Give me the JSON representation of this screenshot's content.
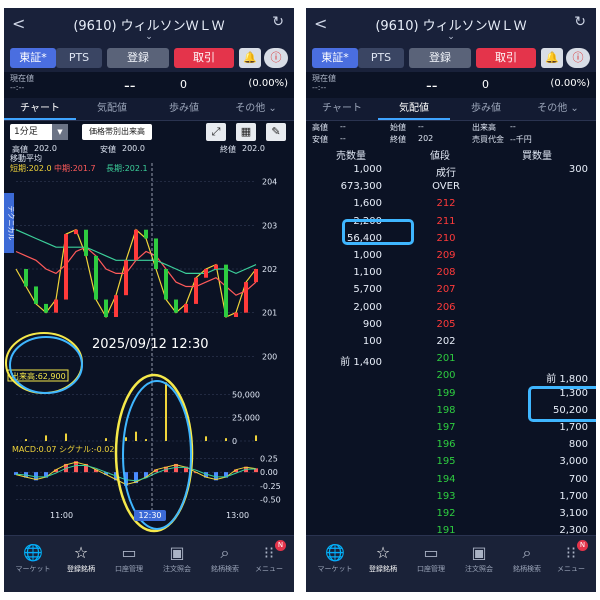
{
  "left": {
    "header": {
      "back": "<",
      "title": "(9610) ウィルソンＷＬＷ",
      "chevron": "⌄",
      "refresh": "↻"
    },
    "buttons": {
      "tosho": "東証*",
      "pts": "PTS",
      "register": "登録",
      "trade": "取引",
      "bell": "🔔",
      "info": "ⓘ"
    },
    "price": {
      "label1": "現在値",
      "label2": "--:--",
      "value": "--",
      "change": "0",
      "pct": "(0.00%)"
    },
    "tabs": [
      "チャート",
      "気配値",
      "歩み値",
      "その他 ⌄"
    ],
    "toolbar": {
      "interval": "1分足",
      "volume_by_price": "価格帯別出来高",
      "expand_icon": "⤢",
      "grid_icon": "▦",
      "pen_icon": "✎"
    },
    "hl": {
      "high": "高値",
      "high_v": "202.0",
      "low": "安値",
      "low_v": "200.0",
      "close": "終値",
      "close_v": "202.0"
    },
    "ma": {
      "label": "移動平均",
      "short": "短期:202.0",
      "mid": "中期:201.7",
      "long": "長期:202.1"
    },
    "side_tab": "テクニカル",
    "chart_data": [
      {
        "type": "line",
        "title": "",
        "y_ticks": [
          "204",
          "203",
          "202",
          "201",
          "200"
        ],
        "ylim": [
          199.8,
          204.2
        ],
        "series": [
          {
            "name": "短期",
            "color": "#f0d43a",
            "values": [
              202.0,
              201.6,
              201.2,
              201.0,
              201.3,
              202.8,
              202.9,
              202.3,
              201.3,
              200.9,
              201.4,
              202.2,
              202.9,
              202.7,
              202.0,
              201.3,
              201.0,
              201.2,
              201.8,
              202.0,
              202.1,
              200.9,
              201.0,
              201.7,
              202.0
            ]
          },
          {
            "name": "中期",
            "color": "#ff5a5a",
            "values": [
              202.4,
              202.3,
              202.2,
              202.0,
              201.9,
              202.1,
              202.4,
              202.5,
              202.3,
              202.0,
              201.9,
              201.9,
              202.2,
              202.4,
              202.3,
              202.0,
              201.7,
              201.6,
              201.6,
              201.7,
              201.8,
              201.6,
              201.4,
              201.5,
              201.7
            ]
          },
          {
            "name": "長期",
            "color": "#3ccf9a",
            "values": [
              202.9,
              202.8,
              202.7,
              202.6,
              202.5,
              202.5,
              202.5,
              202.5,
              202.4,
              202.3,
              202.2,
              202.2,
              202.2,
              202.2,
              202.2,
              202.1,
              202.0,
              201.9,
              201.9,
              201.9,
              202.0,
              202.0,
              201.9,
              202.0,
              202.1
            ]
          }
        ]
      },
      {
        "type": "bar",
        "title": "出来高:62,900",
        "y_ticks": [
          "50,000",
          "25,000",
          "0"
        ],
        "ylim": [
          0,
          60000
        ],
        "values": [
          0,
          2000,
          0,
          6000,
          0,
          8000,
          0,
          0,
          0,
          3000,
          0,
          4000,
          10000,
          2000,
          0,
          62900,
          0,
          0,
          0,
          5000,
          0,
          3000,
          0,
          0,
          6000
        ]
      },
      {
        "type": "bar",
        "title": "MACD:0.07 シグナル:-0.02",
        "y_ticks": [
          "0.25",
          "0.00",
          "-0.25",
          "-0.50"
        ],
        "ylim": [
          -0.6,
          0.35
        ],
        "values": [
          -0.05,
          -0.1,
          -0.15,
          -0.1,
          0.05,
          0.15,
          0.2,
          0.15,
          0.05,
          -0.05,
          -0.15,
          -0.25,
          -0.2,
          -0.1,
          0.05,
          0.1,
          0.15,
          0.1,
          0.0,
          -0.1,
          -0.15,
          -0.1,
          0.05,
          0.1,
          0.07
        ]
      }
    ],
    "cursor": {
      "datetime": "2025/09/12 12:30",
      "time_label": "12:30"
    },
    "x_ticks": [
      "11:00",
      "13:00"
    ]
  },
  "right": {
    "header": {
      "back": "<",
      "title": "(9610) ウィルソンＷＬＷ",
      "chevron": "⌄",
      "refresh": "↻"
    },
    "buttons": {
      "tosho": "東証*",
      "pts": "PTS",
      "register": "登録",
      "trade": "取引",
      "bell": "🔔",
      "info": "ⓘ"
    },
    "price": {
      "label1": "現在値",
      "label2": "--:--",
      "value": "--",
      "change": "0",
      "pct": "(0.00%)"
    },
    "tabs": [
      "チャート",
      "気配値",
      "歩み値",
      "その他 ⌄"
    ],
    "stats": {
      "high": "高値",
      "high_v": "--",
      "open": "始値",
      "open_v": "--",
      "turnover": "出来高",
      "turnover_v": "--",
      "low": "安値",
      "low_v": "--",
      "close": "終値",
      "close_v": "202",
      "amount": "売買代金",
      "amount_v": "--千円"
    },
    "book_head": {
      "sell": "売数量",
      "price": "値段",
      "buy": "買数量"
    },
    "book": [
      {
        "sell": "1,000",
        "price": "成行",
        "buy": "300",
        "pc": "white"
      },
      {
        "sell": "673,300",
        "price": "OVER",
        "buy": "",
        "pc": "white"
      },
      {
        "sell": "1,600",
        "price": "212",
        "buy": "",
        "pc": "red"
      },
      {
        "sell": "2,200",
        "price": "211",
        "buy": "",
        "pc": "red"
      },
      {
        "sell": "56,400",
        "price": "210",
        "buy": "",
        "pc": "red"
      },
      {
        "sell": "1,000",
        "price": "209",
        "buy": "",
        "pc": "red"
      },
      {
        "sell": "1,100",
        "price": "208",
        "buy": "",
        "pc": "red"
      },
      {
        "sell": "5,700",
        "price": "207",
        "buy": "",
        "pc": "red"
      },
      {
        "sell": "2,000",
        "price": "206",
        "buy": "",
        "pc": "red"
      },
      {
        "sell": "900",
        "price": "205",
        "buy": "",
        "pc": "red"
      },
      {
        "sell": "100",
        "price": "202",
        "buy": "",
        "pc": "white"
      },
      {
        "sell": "前 1,400",
        "price": "201",
        "buy": "",
        "pc": "green"
      },
      {
        "sell": "",
        "price": "200",
        "buy": "前 1,800",
        "pc": "green"
      },
      {
        "sell": "",
        "price": "199",
        "buy": "1,300",
        "pc": "green"
      },
      {
        "sell": "",
        "price": "198",
        "buy": "50,200",
        "pc": "green"
      },
      {
        "sell": "",
        "price": "197",
        "buy": "1,700",
        "pc": "green"
      },
      {
        "sell": "",
        "price": "196",
        "buy": "800",
        "pc": "green"
      },
      {
        "sell": "",
        "price": "195",
        "buy": "3,000",
        "pc": "green"
      },
      {
        "sell": "",
        "price": "194",
        "buy": "700",
        "pc": "green"
      },
      {
        "sell": "",
        "price": "193",
        "buy": "1,700",
        "pc": "green"
      },
      {
        "sell": "",
        "price": "192",
        "buy": "3,100",
        "pc": "green"
      },
      {
        "sell": "",
        "price": "191",
        "buy": "2,300",
        "pc": "green"
      }
    ]
  },
  "footer": [
    {
      "icon": "🌐",
      "label": "マーケット"
    },
    {
      "icon": "☆",
      "label": "登録銘柄"
    },
    {
      "icon": "▭",
      "label": "口座管理"
    },
    {
      "icon": "▣",
      "label": "注文照会"
    },
    {
      "icon": "⌕",
      "label": "銘柄検索"
    },
    {
      "icon": "⁝⁝",
      "label": "メニュー",
      "badge": "N"
    }
  ],
  "colors": {
    "accent": "#3fa4ff",
    "up": "#ff3a3a",
    "down": "#2ecc40",
    "highlight_blue": "#3fb6ff",
    "highlight_yellow": "#f5e84a"
  }
}
